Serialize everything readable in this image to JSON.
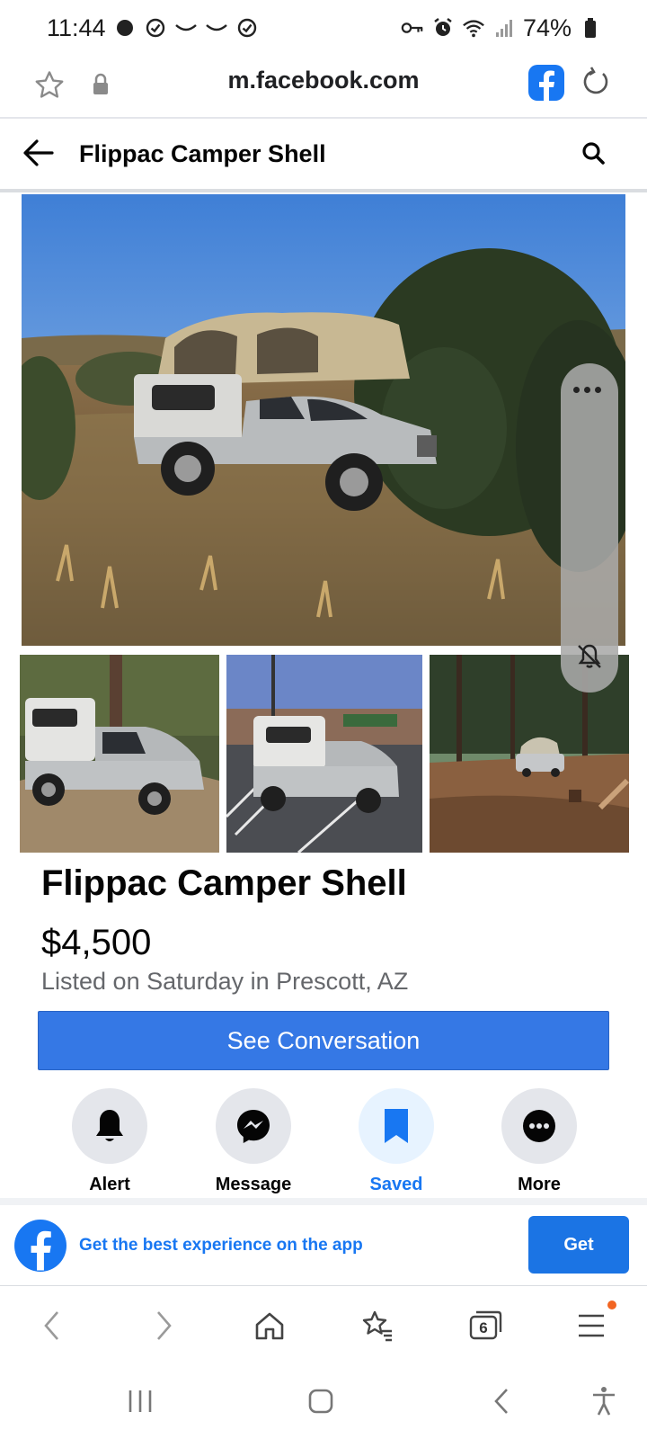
{
  "status_bar": {
    "time": "11:44",
    "battery": "74%"
  },
  "browser": {
    "url": "m.facebook.com",
    "tab_count": "6"
  },
  "header": {
    "title": "Flippac Camper Shell"
  },
  "listing": {
    "title": "Flippac Camper Shell",
    "price": "$4,500",
    "meta": "Listed on Saturday in Prescott, AZ",
    "cta": "See Conversation"
  },
  "actions": [
    {
      "label": "Alert",
      "icon": "bell-icon"
    },
    {
      "label": "Message",
      "icon": "messenger-icon"
    },
    {
      "label": "Saved",
      "icon": "bookmark-icon"
    },
    {
      "label": "More",
      "icon": "more-dots-icon"
    }
  ],
  "app_banner": {
    "text": "Get the best experience on the app",
    "button": "Get"
  },
  "colors": {
    "facebook_blue": "#1877f2",
    "cta_blue": "#3578e5",
    "secondary_text": "#65676b",
    "notification_dot": "#f26522"
  }
}
